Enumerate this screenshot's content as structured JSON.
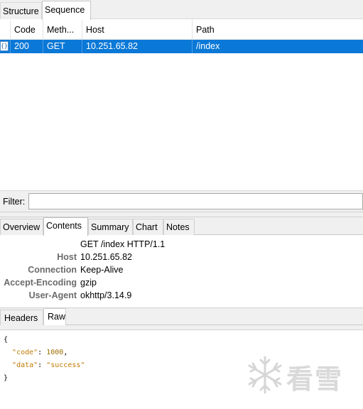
{
  "top_tabs": [
    "Structure",
    "Sequence"
  ],
  "table": {
    "columns": [
      "Code",
      "Meth...",
      "Host",
      "Path"
    ],
    "rows": [
      {
        "icon": "json-icon",
        "icon_text": "{}",
        "code": "200",
        "method": "GET",
        "host": "10.251.65.82",
        "path": "/index"
      }
    ]
  },
  "filter": {
    "label": "Filter:",
    "value": ""
  },
  "inspector_tabs": [
    "Overview",
    "Contents",
    "Summary",
    "Chart",
    "Notes"
  ],
  "request": {
    "line": "GET /index HTTP/1.1",
    "headers": [
      {
        "key": "Host",
        "value": "10.251.65.82"
      },
      {
        "key": "Connection",
        "value": "Keep-Alive"
      },
      {
        "key": "Accept-Encoding",
        "value": "gzip"
      },
      {
        "key": "User-Agent",
        "value": "okhttp/3.14.9"
      }
    ]
  },
  "sub_tabs": [
    "Headers",
    "Raw"
  ],
  "json_body": {
    "open": "{",
    "code_key": "\"code\"",
    "code_value": "1000",
    "data_key": "\"data\"",
    "data_value": "\"success\"",
    "close": "}"
  },
  "watermark": {
    "text": "看雪",
    "icon": "snowflake-logo"
  },
  "colors": {
    "selection": "#0a78d7",
    "json_key": "#c07a00",
    "chrome": "#f0f0f0"
  }
}
